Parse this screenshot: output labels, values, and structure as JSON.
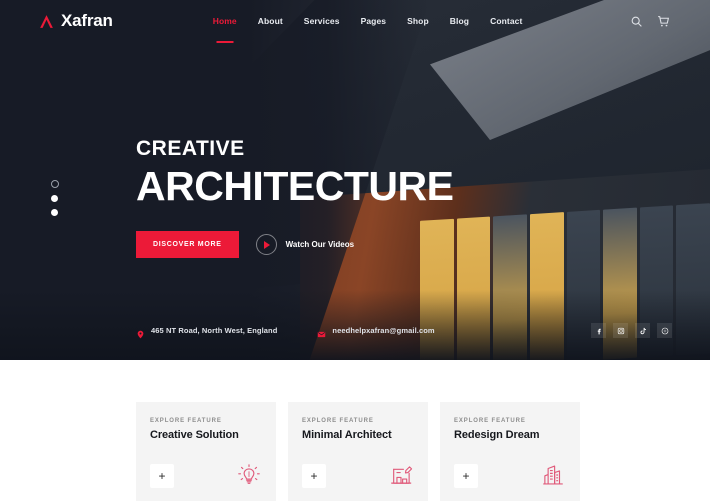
{
  "theme": {
    "accent": "#ec1a38",
    "dark": "#171b26",
    "card_bg": "#f4f4f4",
    "text_light": "#ffffff"
  },
  "navbar": {
    "logo_text": "Xafran",
    "logo_icon": "triangle-a-logo-icon",
    "links": [
      {
        "label": "Home",
        "active": true
      },
      {
        "label": "About",
        "active": false
      },
      {
        "label": "Services",
        "active": false
      },
      {
        "label": "Pages",
        "active": false
      },
      {
        "label": "Shop",
        "active": false
      },
      {
        "label": "Blog",
        "active": false
      },
      {
        "label": "Contact",
        "active": false
      }
    ],
    "actions": [
      {
        "icon": "search-icon"
      },
      {
        "icon": "cart-icon"
      }
    ]
  },
  "hero": {
    "subtitle": "CREATIVE",
    "title": "ARCHITECTURE",
    "primary_button": "DISCOVER MORE",
    "video_label": "Watch Our Videos",
    "play_icon": "play-icon",
    "slider_dots": [
      {
        "active": true
      },
      {
        "active": false
      },
      {
        "active": false
      }
    ],
    "info": {
      "address_icon": "map-pin-icon",
      "address": "465 NT Road, North West, England",
      "email_icon": "envelope-icon",
      "email": "needhelpxafran@gmail.com"
    },
    "socials": [
      {
        "name": "facebook-icon",
        "glyph": "f"
      },
      {
        "name": "instagram-icon",
        "glyph": "▣"
      },
      {
        "name": "tiktok-icon",
        "glyph": "♪"
      },
      {
        "name": "behance-icon",
        "glyph": "Œ"
      }
    ]
  },
  "features": {
    "cards": [
      {
        "label": "EXPLORE FEATURE",
        "title": "Creative Solution",
        "plus": "+",
        "icon": "lightbulb-idea-icon"
      },
      {
        "label": "EXPLORE FEATURE",
        "title": "Minimal Architect",
        "plus": "+",
        "icon": "blueprint-drafting-icon"
      },
      {
        "label": "EXPLORE FEATURE",
        "title": "Redesign Dream",
        "plus": "+",
        "icon": "building-skyscraper-icon"
      }
    ]
  }
}
